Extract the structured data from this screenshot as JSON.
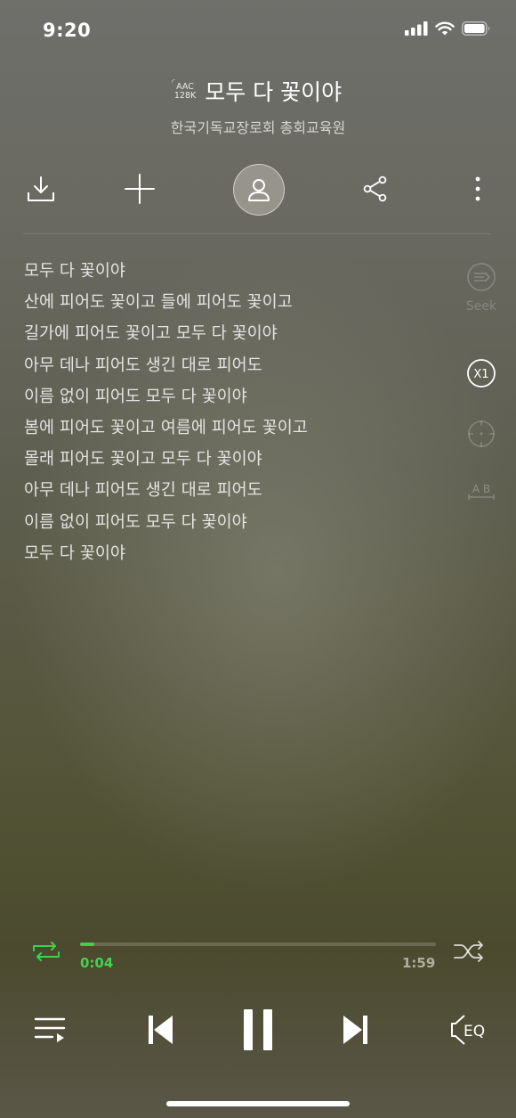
{
  "status_bar": {
    "time": "9:20"
  },
  "header": {
    "codec_line1": "AAC",
    "codec_line2": "128K",
    "title": "모두 다 꽃이야",
    "artist": "한국기독교장로회 총회교육원"
  },
  "lyrics": [
    "모두 다 꽃이야",
    "산에 피어도 꽃이고 들에 피어도 꽃이고",
    "길가에 피어도 꽃이고 모두 다 꽃이야",
    "아무 데나 피어도 생긴 대로 피어도",
    "이름 없이 피어도 모두 다 꽃이야",
    "봄에 피어도 꽃이고 여름에 피어도 꽃이고",
    "몰래 피어도 꽃이고 모두 다 꽃이야",
    "아무 데나 피어도 생긴 대로 피어도",
    "이름 없이 피어도 모두 다 꽃이야",
    "모두 다 꽃이야"
  ],
  "side_tools": {
    "seek_label": "Seek",
    "speed_label": "X1",
    "ab_label": "A B"
  },
  "progress": {
    "elapsed": "0:04",
    "total": "1:59",
    "fraction": 0.04
  },
  "controls": {
    "eq_label": "EQ"
  },
  "colors": {
    "accent": "#3fd04e"
  }
}
